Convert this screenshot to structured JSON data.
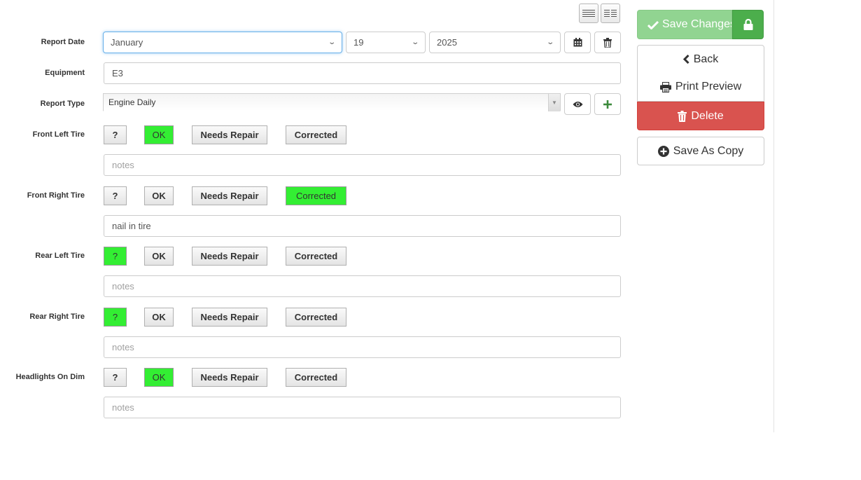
{
  "toolbar": {
    "list_view_icon": "list-view-icon",
    "grid_view_icon": "columns-view-icon"
  },
  "report_date": {
    "label": "Report Date",
    "month": "January",
    "day": "19",
    "year": "2025"
  },
  "equipment": {
    "label": "Equipment",
    "value": "E3"
  },
  "report_type": {
    "label": "Report Type",
    "value": "Engine Daily"
  },
  "status_options": {
    "unknown": "?",
    "ok": "OK",
    "needs_repair": "Needs Repair",
    "corrected": "Corrected"
  },
  "notes_placeholder": "notes",
  "items": [
    {
      "label": "Front Left Tire",
      "selected": "ok",
      "notes": ""
    },
    {
      "label": "Front Right Tire",
      "selected": "corrected",
      "notes": "nail in tire"
    },
    {
      "label": "Rear Left Tire",
      "selected": "unknown",
      "notes": ""
    },
    {
      "label": "Rear Right Tire",
      "selected": "unknown",
      "notes": ""
    },
    {
      "label": "Headlights On Dim",
      "selected": "ok",
      "notes": ""
    }
  ],
  "panel": {
    "save_changes": "Save Changes",
    "back": "Back",
    "print_preview": "Print Preview",
    "delete": "Delete",
    "save_as_copy": "Save As Copy"
  },
  "colors": {
    "selected": "#33ee33",
    "save": "#91d491",
    "lock": "#4cae4c",
    "delete": "#d9534f"
  }
}
